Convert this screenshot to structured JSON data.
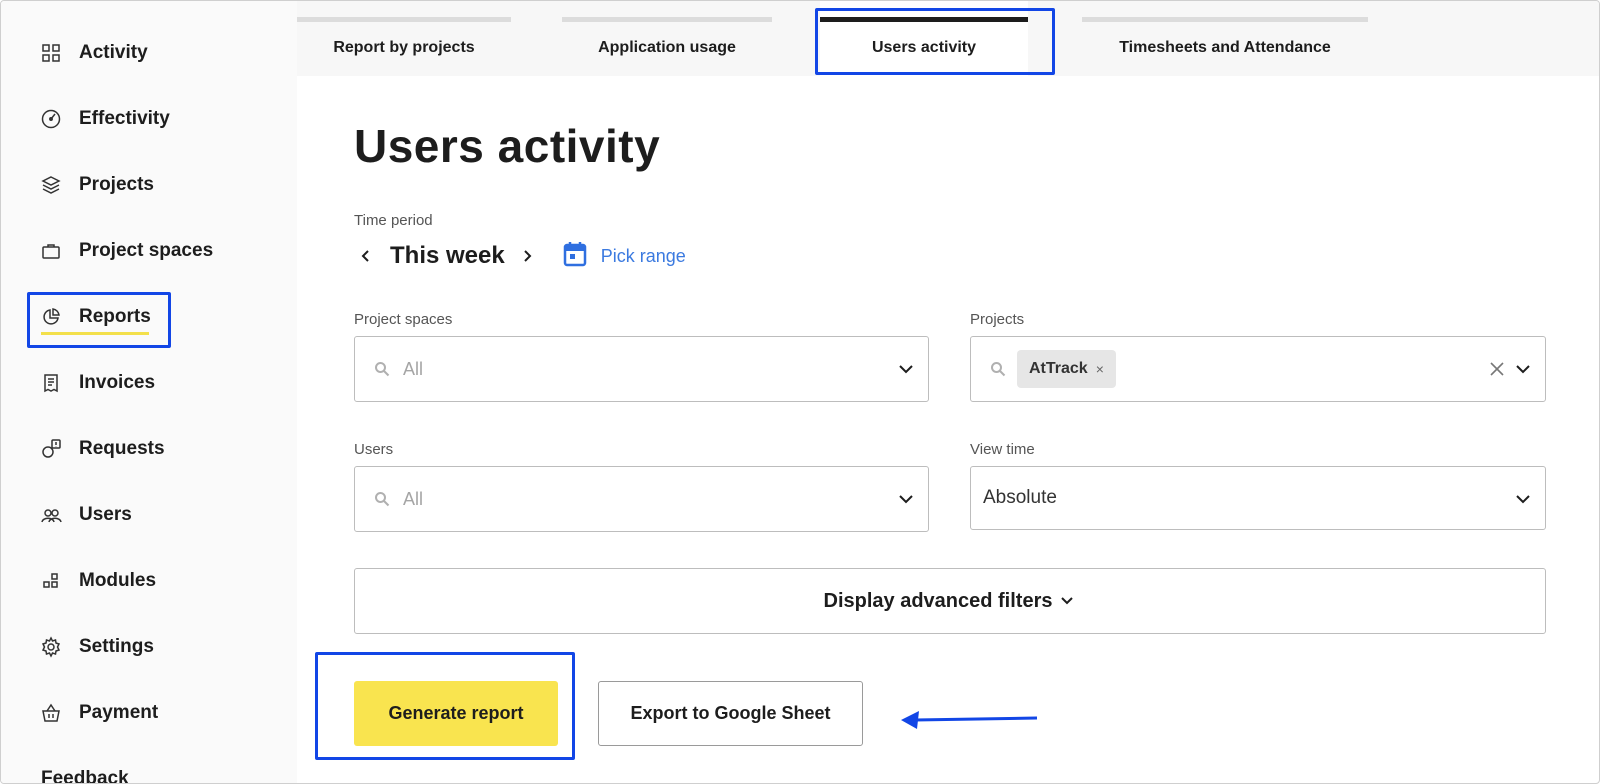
{
  "sidebar": {
    "items": [
      {
        "label": "Activity",
        "icon": "grid-icon"
      },
      {
        "label": "Effectivity",
        "icon": "gauge-icon"
      },
      {
        "label": "Projects",
        "icon": "layers-icon"
      },
      {
        "label": "Project spaces",
        "icon": "briefcase-icon"
      },
      {
        "label": "Reports",
        "icon": "pie-chart-icon",
        "active": true
      },
      {
        "label": "Invoices",
        "icon": "receipt-icon"
      },
      {
        "label": "Requests",
        "icon": "request-icon"
      },
      {
        "label": "Users",
        "icon": "users-icon"
      },
      {
        "label": "Modules",
        "icon": "modules-icon"
      },
      {
        "label": "Settings",
        "icon": "gear-icon"
      },
      {
        "label": "Payment",
        "icon": "basket-icon"
      }
    ],
    "feedback_label": "Feedback"
  },
  "tabs": [
    {
      "label": "Report by projects"
    },
    {
      "label": "Application usage"
    },
    {
      "label": "Users activity",
      "active": true
    },
    {
      "label": "Timesheets and Attendance"
    }
  ],
  "main": {
    "title": "Users activity",
    "time_period": {
      "label": "Time period",
      "value": "This week",
      "pick_range_label": "Pick range"
    },
    "project_spaces": {
      "label": "Project spaces",
      "placeholder": "All"
    },
    "projects": {
      "label": "Projects",
      "selected_chip": "AtTrack",
      "chip_remove": "×"
    },
    "users": {
      "label": "Users",
      "placeholder": "All"
    },
    "view_time": {
      "label": "View time",
      "value": "Absolute"
    },
    "advanced_filters_label": "Display advanced filters",
    "generate_label": "Generate report",
    "export_label": "Export to Google Sheet"
  },
  "colors": {
    "accent_yellow": "#f9e44f",
    "highlight_blue": "#1246e6",
    "link_blue": "#3b7ae0"
  }
}
